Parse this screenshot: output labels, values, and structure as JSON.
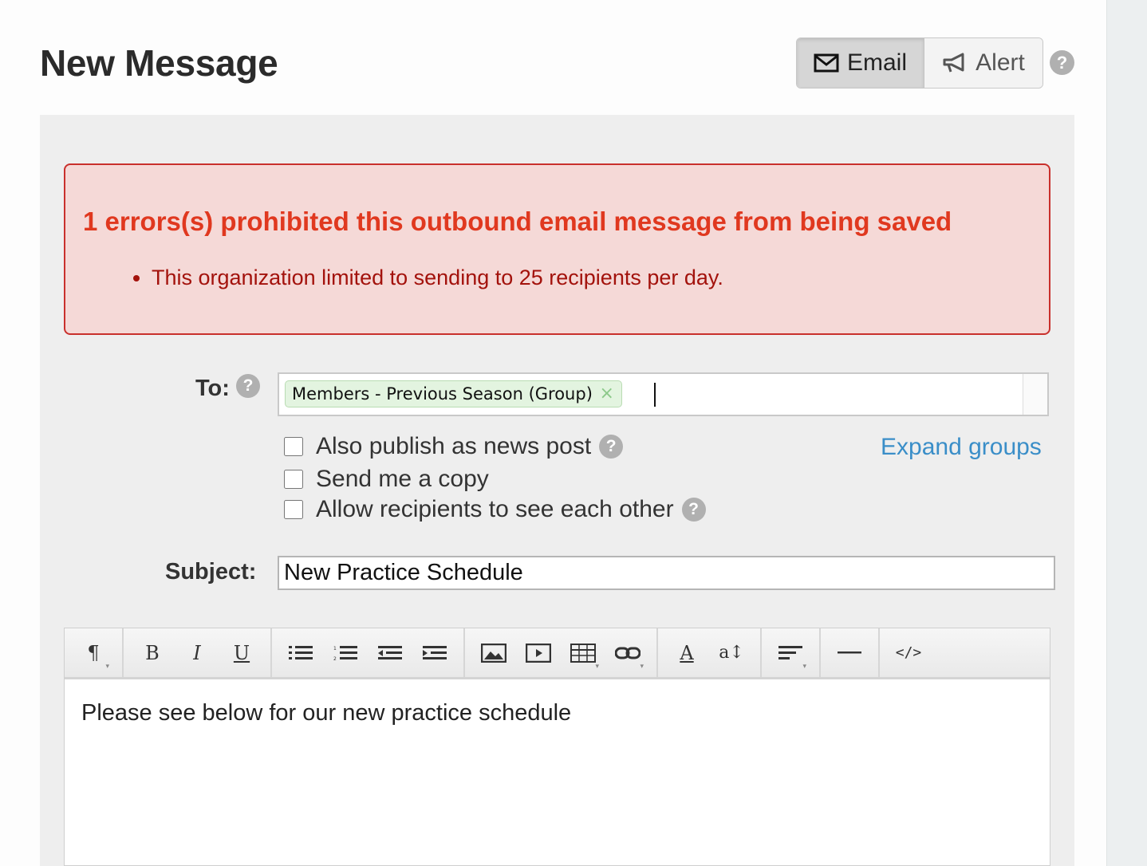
{
  "page": {
    "title": "New Message"
  },
  "mode": {
    "email_label": "Email",
    "alert_label": "Alert",
    "selected": "Email"
  },
  "error": {
    "title": "1 errors(s) prohibited this outbound email message from being saved",
    "items": [
      "This organization limited to sending to 25 recipients per day."
    ]
  },
  "form": {
    "to_label": "To:",
    "recipients": [
      {
        "label": "Members - Previous Season (Group)"
      }
    ],
    "remove_glyph": "×",
    "options": [
      {
        "label": "Also publish as news post",
        "checked": false,
        "help": true
      },
      {
        "label": "Send me a copy",
        "checked": false,
        "help": false
      },
      {
        "label": "Allow recipients to see each other",
        "checked": false,
        "help": true
      }
    ],
    "expand_groups": "Expand groups",
    "subject_label": "Subject:",
    "subject_value": "New Practice Schedule"
  },
  "editor": {
    "body_text": "Please see below for our new practice schedule",
    "toolbar_icons": [
      "paragraph-icon",
      "bold-icon",
      "italic-icon",
      "underline-icon",
      "unordered-list-icon",
      "ordered-list-icon",
      "outdent-icon",
      "indent-icon",
      "image-icon",
      "video-icon",
      "table-icon",
      "link-icon",
      "font-color-icon",
      "font-size-icon",
      "align-icon",
      "horizontal-rule-icon",
      "html-code-icon"
    ]
  },
  "colors": {
    "accent_link": "#3a8ec8",
    "error_text": "#e0381f",
    "error_bg": "#f5d9d7",
    "token_bg": "#e3f4e0"
  }
}
